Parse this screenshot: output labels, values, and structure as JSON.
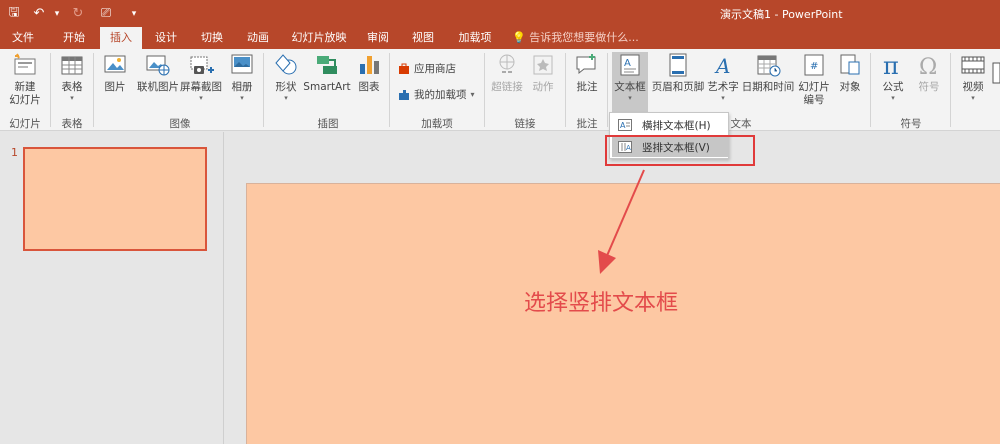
{
  "window": {
    "title": "演示文稿1 - PowerPoint"
  },
  "qat": [
    {
      "name": "save-icon",
      "glyph": "🖫"
    },
    {
      "name": "undo-icon",
      "glyph": "↶"
    },
    {
      "name": "undo-dropdown-icon",
      "glyph": "▾"
    },
    {
      "name": "redo-icon",
      "glyph": "↻"
    },
    {
      "name": "present-icon",
      "glyph": "⎚"
    },
    {
      "name": "customize-qat-icon",
      "glyph": "▾"
    }
  ],
  "tabs": [
    "文件",
    "开始",
    "插入",
    "设计",
    "切换",
    "动画",
    "幻灯片放映",
    "审阅",
    "视图",
    "加载项"
  ],
  "active_tab": "插入",
  "tellme": {
    "text": "告诉我您想要做什么..."
  },
  "ribbon": {
    "new_slide": "新建\n幻灯片",
    "table": "表格",
    "picture": "图片",
    "online_picture": "联机图片",
    "screenshot": "屏幕截图",
    "album": "相册",
    "shapes": "形状",
    "smartart": "SmartArt",
    "chart": "图表",
    "store": "应用商店",
    "my_addins": "我的加载项",
    "hyperlink": "超链接",
    "action": "动作",
    "comment": "批注",
    "textbox": "文本框",
    "header_footer": "页眉和页脚",
    "wordart": "艺术字",
    "datetime": "日期和时间",
    "slide_number": "幻灯片\n编号",
    "object": "对象",
    "equation": "公式",
    "symbol": "符号",
    "video": "视频"
  },
  "groups": {
    "slides": "幻灯片",
    "tables": "表格",
    "images": "图像",
    "illustrations": "插图",
    "addins": "加载项",
    "links": "链接",
    "comments": "批注",
    "text": "文本",
    "symbols": "符号"
  },
  "dropdown": {
    "items": [
      "横排文本框(H)",
      "竖排文本框(V)"
    ],
    "selected_index": 1
  },
  "slides": {
    "thumb_number": "1"
  },
  "annotation": {
    "text": "选择竖排文本框"
  },
  "colors": {
    "accent": "#b7472a",
    "slide_bg": "#fdc8a3",
    "annotation": "#e34b4b"
  }
}
